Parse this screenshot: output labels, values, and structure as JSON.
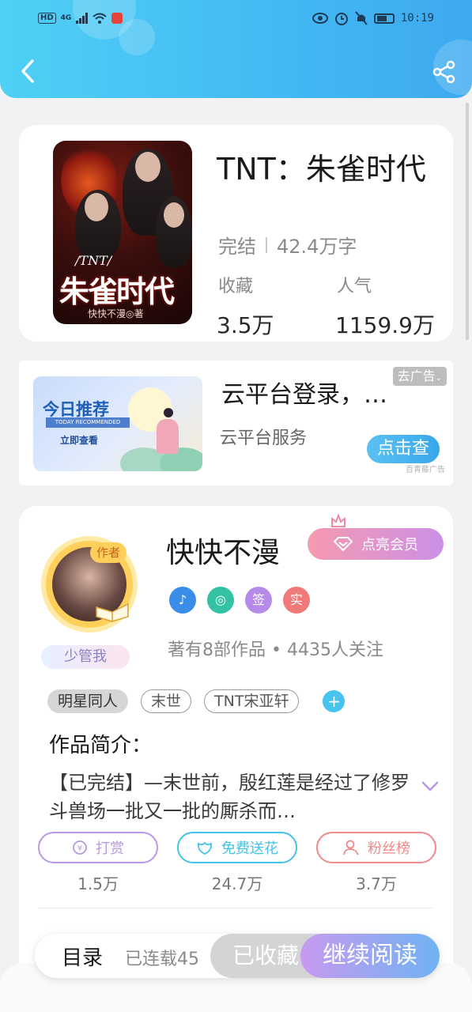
{
  "status_bar": {
    "network": "HD",
    "signal": "4G",
    "time": "10:19"
  },
  "header": {
    "back_icon": "chevron-left-icon",
    "share_icon": "share-icon",
    "bg_color": "#43b8f2"
  },
  "book": {
    "cover_series": "/TNT/",
    "cover_title": "朱雀时代",
    "cover_author": "快快不漫◎著",
    "title": "TNT：朱雀时代",
    "status": "完结",
    "word_count": "42.4万字",
    "favorites_label": "收藏",
    "favorites_value": "3.5万",
    "popularity_label": "人气",
    "popularity_value": "1159.9万"
  },
  "ad": {
    "img_title": "今日推荐",
    "img_subtitle": "TODAY RECOMMENDED",
    "img_cta": "立即查看",
    "title": "云平台登录，…",
    "subtitle": "云平台服务",
    "close_label": "去广告",
    "button_label": "点击查",
    "source": "百青藤广告"
  },
  "author": {
    "tag": "作者",
    "name": "快快不漫",
    "vip_label": "点亮会员",
    "fan_badge": "少管我",
    "badges": [
      {
        "icon": "music-note-icon",
        "glyph": "♪",
        "color": "#3b8ee8"
      },
      {
        "icon": "handshake-icon",
        "glyph": "◎",
        "color": "#34c2a4"
      },
      {
        "icon": "sign-icon",
        "glyph": "签",
        "color": "#b58ae8"
      },
      {
        "icon": "verified-icon",
        "glyph": "实",
        "color": "#f07a7a"
      }
    ],
    "info": "著有8部作品 • 4435人关注",
    "tags": [
      "明星同人",
      "末世",
      "TNT宋亚轩"
    ],
    "intro_title": "作品简介：",
    "intro_text": "【已完结】—末世前，殷红莲是经过了修罗斗兽场一批又一批的厮杀而…",
    "actions": [
      {
        "label": "打赏",
        "count": "1.5万",
        "color": "#b897e6",
        "icon": "coin-icon"
      },
      {
        "label": "免费送花",
        "count": "24.7万",
        "color": "#45c2e8",
        "icon": "flower-icon"
      },
      {
        "label": "粉丝榜",
        "count": "3.7万",
        "color": "#f08a8a",
        "icon": "fans-icon"
      }
    ]
  },
  "bottom_bar": {
    "toc_label": "目录",
    "serial_label": "已连载45",
    "collected_label": "已收藏",
    "read_label": "继续阅读"
  }
}
